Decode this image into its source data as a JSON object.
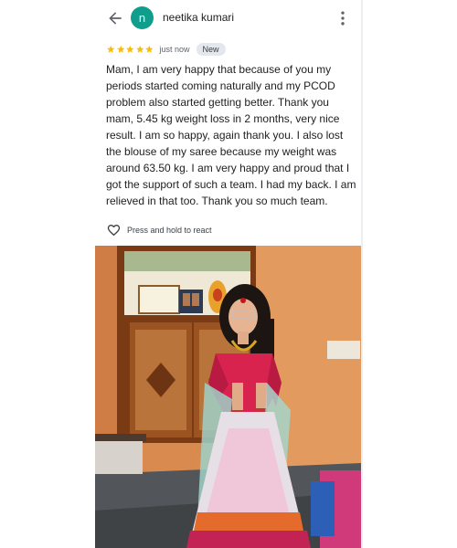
{
  "review": {
    "author_initial": "n",
    "author_name": "neetika kumari",
    "rating": 5,
    "time": "just now",
    "badge": "New",
    "text": "Mam, I am very happy that because of you my periods started coming naturally and my PCOD problem also started getting better. Thank you mam, 5.45 kg weight loss in 2 months, very nice result. I am so happy, again thank you. I also lost the blouse of my saree because my weight was around 63.50 kg. I am very happy and proud that I got the support of such a team. I had my back. I am relieved in that too. Thank you so much team.",
    "react_label": "Press and hold to react"
  },
  "icons": {
    "back": "arrow-back-icon",
    "more": "more-vert-icon",
    "star": "star-icon",
    "heart": "heart-outline-icon"
  },
  "colors": {
    "avatar": "#0f9d8c",
    "star": "#fbbc04",
    "icon": "#5f6368",
    "text": "#202124"
  }
}
